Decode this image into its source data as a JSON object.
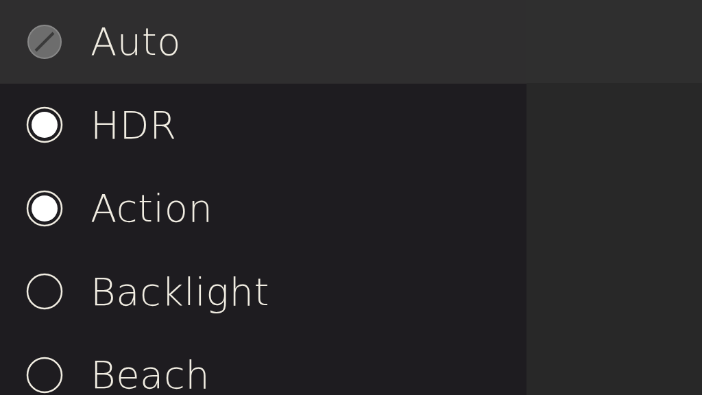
{
  "modes": [
    {
      "label": "Auto",
      "kind": "auto",
      "focused": true
    },
    {
      "label": "HDR",
      "kind": "radio",
      "checked": true,
      "focused": false
    },
    {
      "label": "Action",
      "kind": "radio",
      "checked": true,
      "focused": false
    },
    {
      "label": "Backlight",
      "kind": "radio",
      "checked": false,
      "focused": false
    },
    {
      "label": "Beach",
      "kind": "radio",
      "checked": false,
      "focused": false
    }
  ]
}
